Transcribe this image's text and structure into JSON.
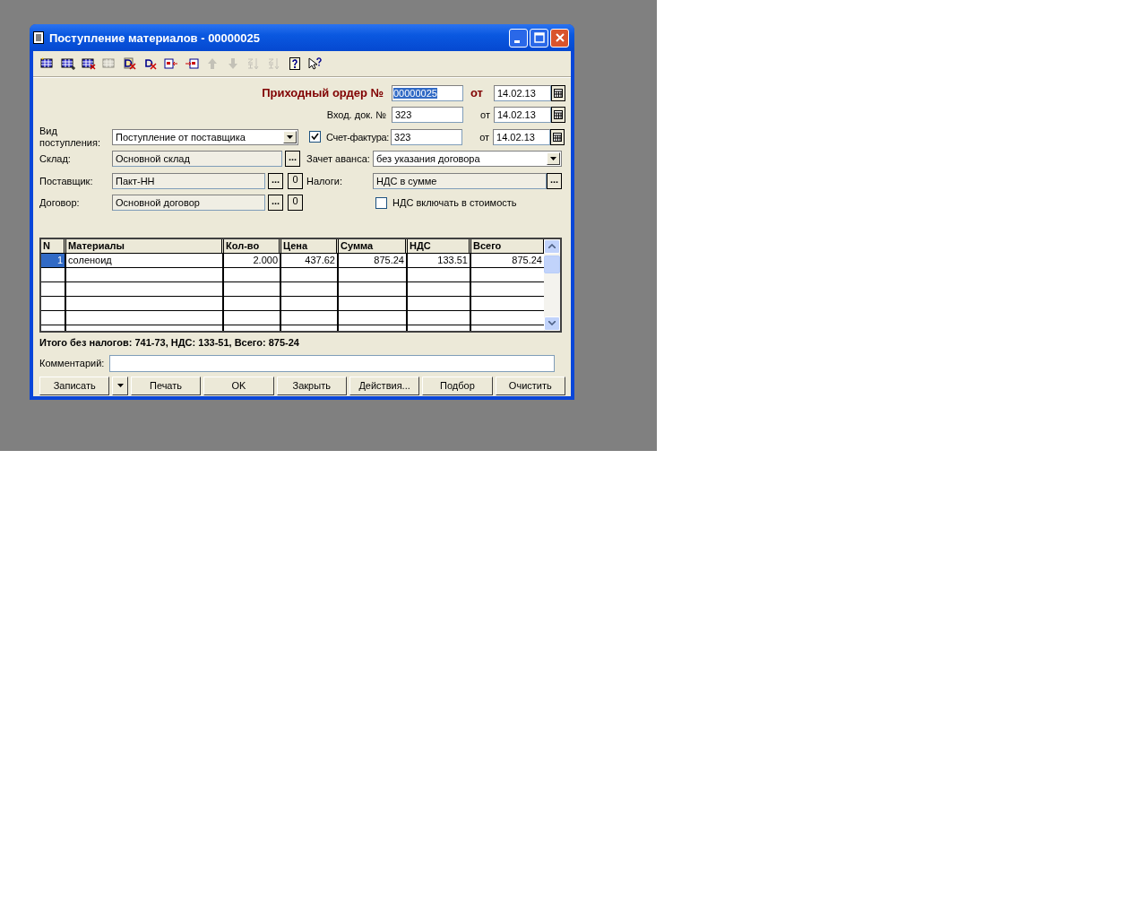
{
  "window": {
    "title": "Поступление материалов - 00000025"
  },
  "toolbar": [
    {
      "kind": "new",
      "disabled": false
    },
    {
      "kind": "add",
      "disabled": false
    },
    {
      "kind": "delete",
      "disabled": false
    },
    {
      "kind": "copy",
      "disabled": true
    },
    {
      "kind": "doc-delete",
      "disabled": false
    },
    {
      "kind": "doc-cross",
      "disabled": false
    },
    {
      "kind": "insert-left",
      "disabled": false
    },
    {
      "kind": "insert-right",
      "disabled": false
    },
    {
      "kind": "up",
      "disabled": true
    },
    {
      "kind": "down",
      "disabled": true
    },
    {
      "kind": "sort-asc",
      "disabled": true
    },
    {
      "kind": "sort-desc",
      "disabled": true
    },
    {
      "kind": "help",
      "disabled": false
    },
    {
      "kind": "whats-this",
      "disabled": false
    }
  ],
  "order": {
    "label": "Приходный ордер №",
    "number": "00000025",
    "date_label": "от",
    "date": "14.02.13"
  },
  "incoming": {
    "label": "Вход. док. №",
    "number": "323",
    "date_label": "от",
    "date": "14.02.13"
  },
  "receipt_type": {
    "label": "Вид поступления:",
    "value": "Поступление от поставщика"
  },
  "invoice": {
    "label": "Счет-фактура:",
    "checked": true,
    "number": "323",
    "date_label": "от",
    "date": "14.02.13"
  },
  "warehouse": {
    "label": "Склад:",
    "value": "Основной склад",
    "select": "..."
  },
  "advance": {
    "label": "Зачет аванса:",
    "value": "без указания договора"
  },
  "supplier": {
    "label": "Поставщик:",
    "value": "Пакт-НН",
    "select": "...",
    "clear": "0"
  },
  "taxes": {
    "label": "Налоги:",
    "value": "НДС в сумме",
    "select": "..."
  },
  "contract": {
    "label": "Договор:",
    "value": "Основной договор",
    "select": "...",
    "clear": "0"
  },
  "vat_in_cost": {
    "label": "НДС включать в стоимость",
    "checked": false
  },
  "table": {
    "columns": [
      "N",
      "Материалы",
      "Кол-во",
      "Цена",
      "Сумма",
      "НДС",
      "Всего"
    ],
    "rows": [
      {
        "selected": true,
        "cells": [
          "1",
          "соленоид",
          "2.000",
          "437.62",
          "875.24",
          "133.51",
          "875.24"
        ]
      }
    ]
  },
  "totals": "Итого без налогов: 741-73, НДС: 133-51, Всего: 875-24",
  "comment": {
    "label": "Комментарий:"
  },
  "buttons": [
    {
      "kind": "button",
      "label": "Записать"
    },
    {
      "kind": "dropdown"
    },
    {
      "kind": "button",
      "label": "Печать"
    },
    {
      "kind": "button",
      "label": "OK"
    },
    {
      "kind": "button",
      "label": "Закрыть"
    },
    {
      "kind": "button",
      "label": "Действия..."
    },
    {
      "kind": "button",
      "label": "Подбор"
    },
    {
      "kind": "button",
      "label": "Очистить"
    }
  ]
}
